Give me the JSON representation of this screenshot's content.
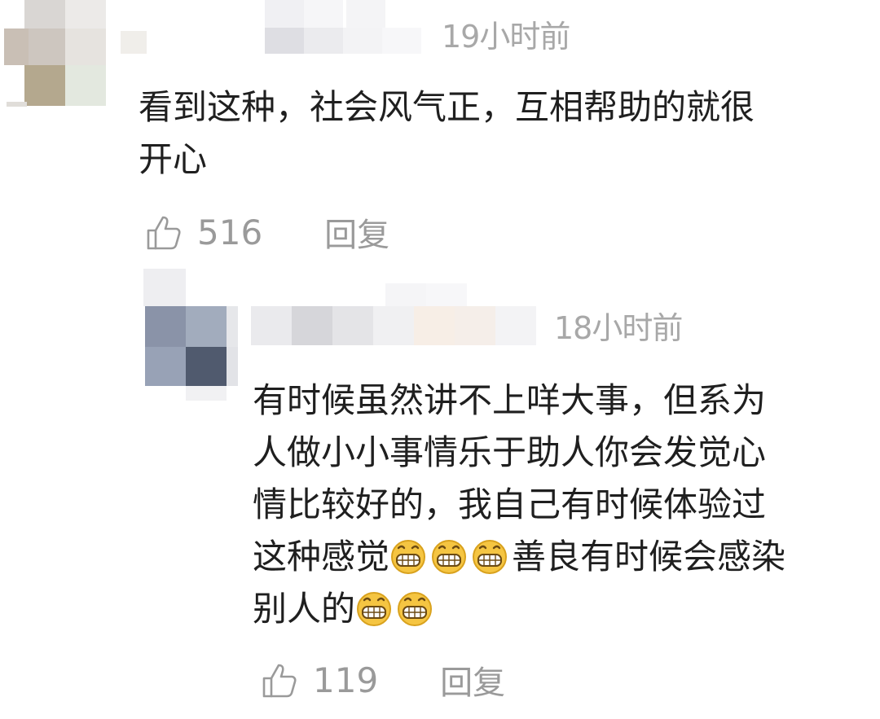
{
  "comments": [
    {
      "time": "19小时前",
      "lines": [
        "看到这种，社会风气正，互相帮助的就很",
        "开心"
      ],
      "likes": "516",
      "reply_label": "回复"
    },
    {
      "time": "18小时前",
      "lines": [
        "有时候虽然讲不上咩大事，但系为",
        "人做小小事情乐于助人你会发觉心",
        "情比较好的，我自己有时候体验过"
      ],
      "line4_before": "这种感觉",
      "line4_after": "善良有时候会感染",
      "line5": "别人的",
      "likes": "119",
      "reply_label": "回复"
    }
  ],
  "icons": {
    "like": "thumbs-up-outline-icon",
    "emoji": "grinning-face-emoji"
  },
  "colors": {
    "text": "#1f1f1f",
    "muted": "#9a9a9a",
    "time": "#a8a8a8",
    "emoji_face": "#f5c542"
  }
}
